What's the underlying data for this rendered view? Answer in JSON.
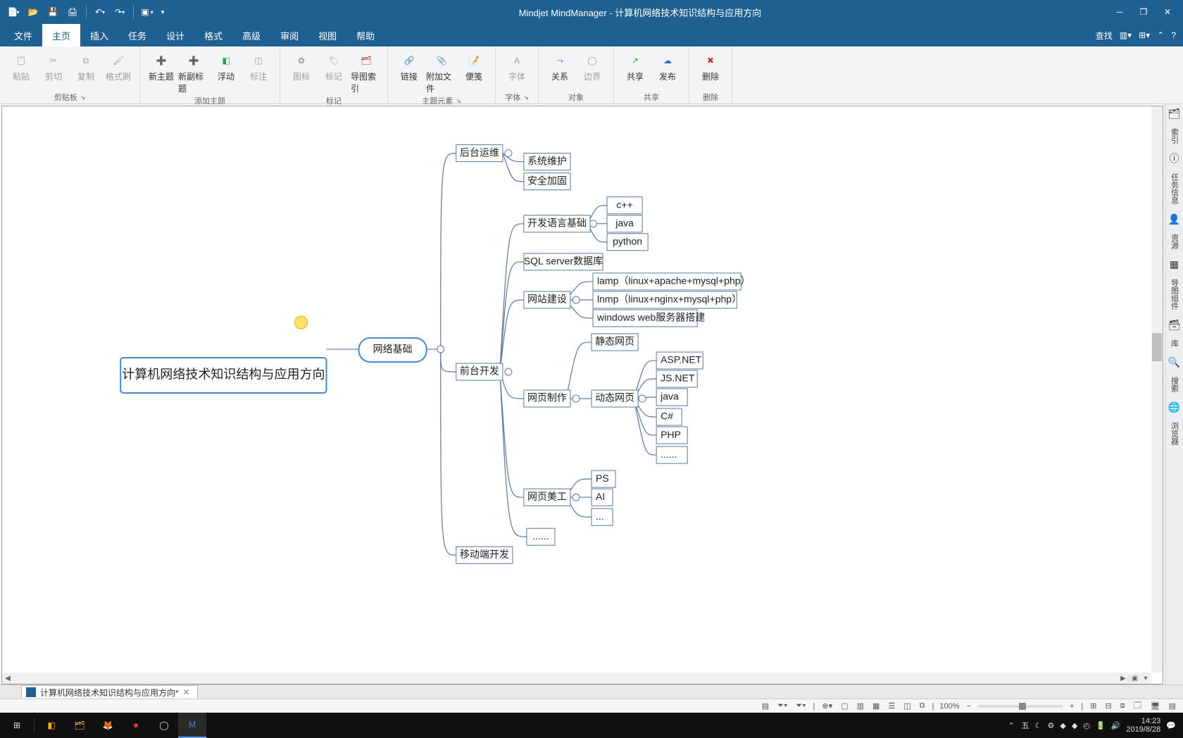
{
  "app": {
    "title": "Mindjet MindManager - 计算机网络技术知识结构与应用方向"
  },
  "tabs": {
    "file": "文件",
    "home": "主页",
    "insert": "插入",
    "task": "任务",
    "design": "设计",
    "format": "格式",
    "advanced": "高级",
    "review": "审阅",
    "view": "视图",
    "help": "帮助",
    "search": "查找"
  },
  "ribbon": {
    "paste": "粘贴",
    "cut": "剪切",
    "copy": "复制",
    "painter": "格式刷",
    "grpClipboard": "剪贴板",
    "newTopic": "新主题",
    "newSub": "新副标题",
    "float": "浮动",
    "callout": "标注",
    "grpAddTopic": "添加主题",
    "image": "图标",
    "marker": "标记",
    "mapIndex": "导图索引",
    "grpMarker": "标记",
    "link": "链接",
    "attach": "附加文件",
    "note": "便笺",
    "grpTopicEl": "主题元素",
    "font": "字体",
    "grpFont": "字体",
    "rel": "关系",
    "boundary": "边界",
    "grpObj": "对象",
    "share": "共享",
    "publish": "发布",
    "grpShare": "共享",
    "delete": "删除",
    "grpDelete": "删除"
  },
  "side": {
    "index": "索引",
    "taskinfo": "任务信息",
    "resource": "资源",
    "mapparts": "导图组件",
    "lib": "库",
    "search": "搜索",
    "browser": "浏览器"
  },
  "mindmap": {
    "root": "计算机网络技术知识结构与应用方向",
    "netBasic": "网络基础",
    "backend": "后台运维",
    "backend_items": [
      "系统维护",
      "安全加固"
    ],
    "langBasic": "开发语言基础",
    "langs": [
      "c++",
      "java",
      "python"
    ],
    "sql": "SQL server数据库",
    "site": "网站建设",
    "site_items": [
      "lamp（linux+apache+mysql+php）",
      "lnmp（linux+nginx+mysql+php）",
      "windows web服务器搭建"
    ],
    "frontend": "前台开发",
    "pageMake": "网页制作",
    "staticPage": "静态网页",
    "dynamicPage": "动态网页",
    "dyn_items": [
      "ASP.NET",
      "JS.NET",
      "java",
      "C#",
      "PHP",
      "......"
    ],
    "pageArt": "网页美工",
    "art_items": [
      "PS",
      "AI",
      "..."
    ],
    "dots": "......",
    "mobile": "移动端开发"
  },
  "doc": {
    "name": "计算机网络技术知识结构与应用方向*"
  },
  "status": {
    "zoom": "100%",
    "ime": "五"
  },
  "clock": {
    "time": "14:23",
    "date": "2019/8/28"
  }
}
